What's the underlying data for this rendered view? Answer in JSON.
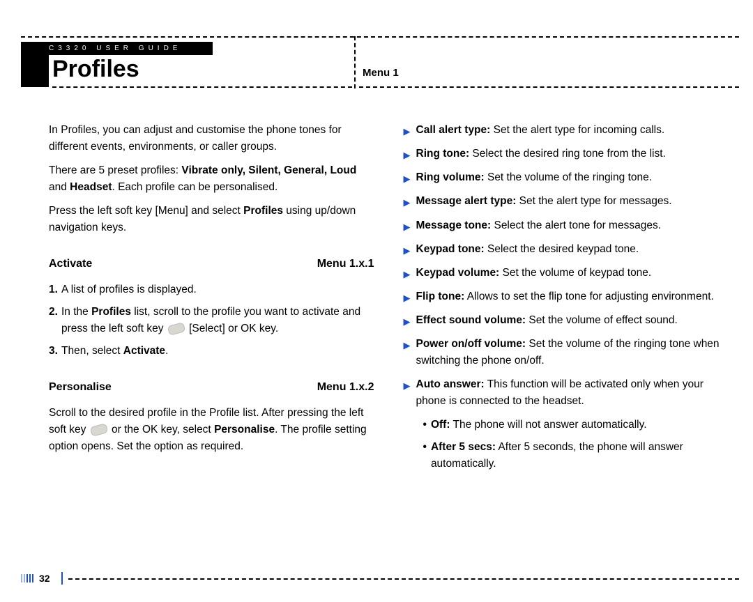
{
  "header_band": "C3320 USER GUIDE",
  "title": "Profiles",
  "menu_label": "Menu 1",
  "page_number": "32",
  "left": {
    "intro1": "In Profiles, you can adjust and customise the phone tones for different events, environments, or caller groups.",
    "intro2a": "There are 5 preset profiles: ",
    "intro2b": "Vibrate only, Silent, General, Loud",
    "intro2c": " and ",
    "intro2d": "Headset",
    "intro2e": ". Each profile can be personalised.",
    "intro3a": "Press the left soft key [Menu] and select ",
    "intro3b": "Profiles",
    "intro3c": " using up/down navigation keys.",
    "activate_title": "Activate",
    "activate_menu": "Menu 1.x.1",
    "a1": "A list of profiles is displayed.",
    "a2a": "In the ",
    "a2b": "Profiles",
    "a2c": " list, scroll to the profile you want to activate and press the left soft key ",
    "a2d": " [Select] or OK key.",
    "a3a": "Then, select ",
    "a3b": "Activate",
    "a3c": ".",
    "personalise_title": "Personalise",
    "personalise_menu": "Menu 1.x.2",
    "p1a": "Scroll to the desired profile in the Profile list. After pressing the left soft key ",
    "p1b": " or the OK key, select ",
    "p1c": "Personalise",
    "p1d": ". The profile setting option opens. Set the option as required."
  },
  "right": {
    "items": [
      {
        "term": "Call alert type:",
        "desc": " Set the alert type for incoming calls."
      },
      {
        "term": "Ring tone:",
        "desc": " Select the desired ring tone from the list."
      },
      {
        "term": "Ring volume:",
        "desc": " Set the volume of the ringing tone."
      },
      {
        "term": "Message alert type:",
        "desc": " Set the alert type for messages."
      },
      {
        "term": "Message tone:",
        "desc": " Select the alert tone for messages."
      },
      {
        "term": "Keypad tone:",
        "desc": " Select the desired keypad tone."
      },
      {
        "term": "Keypad volume:",
        "desc": " Set the volume of keypad tone."
      },
      {
        "term": "Flip tone:",
        "desc": " Allows to set the flip tone for adjusting environment."
      },
      {
        "term": "Effect sound volume:",
        "desc": " Set the volume of effect sound."
      },
      {
        "term": "Power on/off volume:",
        "desc": " Set the volume of the ringing tone when switching the phone on/off."
      },
      {
        "term": "Auto answer:",
        "desc": " This function will be activated only when your phone is connected to the headset."
      }
    ],
    "sub": [
      {
        "term": "Off:",
        "desc": " The phone will not answer automatically."
      },
      {
        "term": "After 5 secs:",
        "desc": " After 5 seconds, the phone will answer automatically."
      }
    ]
  }
}
